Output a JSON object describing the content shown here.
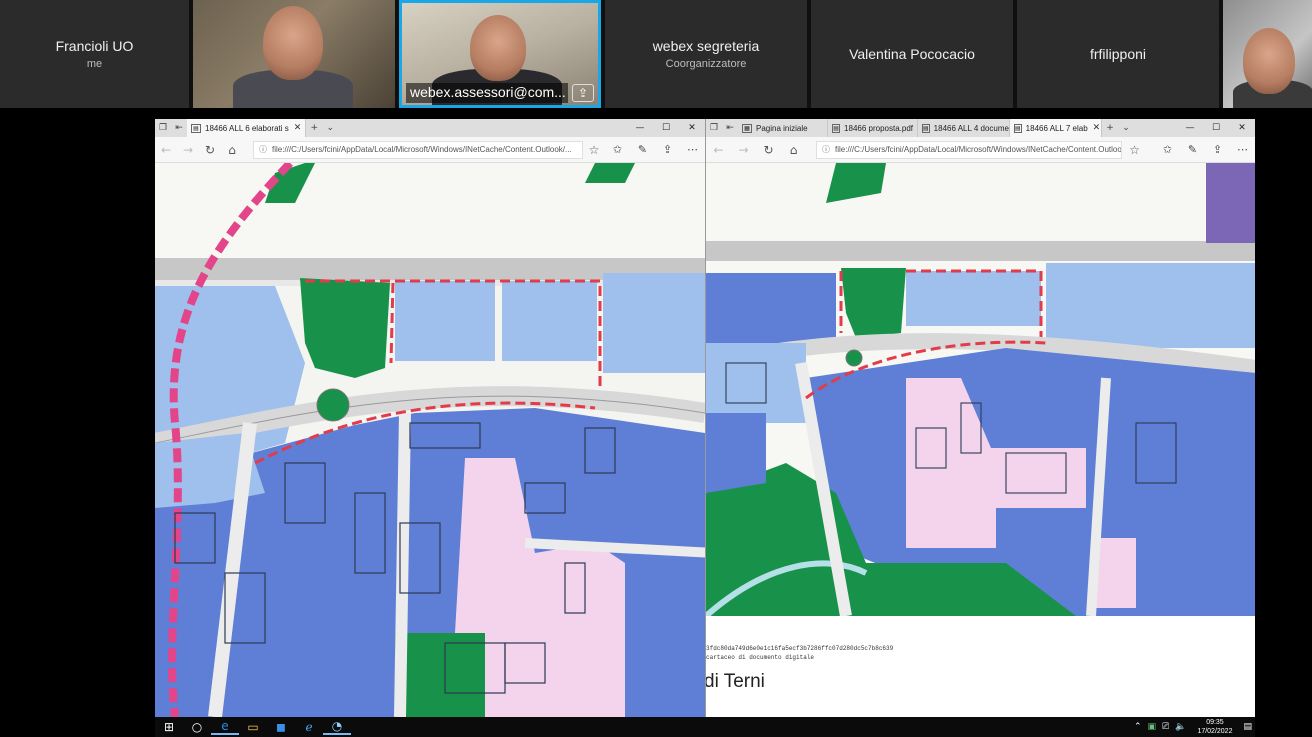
{
  "participants": {
    "tiles": [
      {
        "name": "Francioli UO",
        "sub": "me"
      },
      {
        "name": "webex segreteria",
        "sub": "Coorganizzatore"
      },
      {
        "name": "Valentina Pococacio",
        "sub": ""
      },
      {
        "name": "frfilipponi",
        "sub": ""
      }
    ],
    "active_speaker_label": "webex.assessori@com...",
    "active_speaker_color": "#19a7e8"
  },
  "left_browser": {
    "tab_label": "18466 ALL 6 elaborati s",
    "url": "file:///C:/Users/fcini/AppData/Local/Microsoft/Windows/INetCache/Content.Outlook/..."
  },
  "right_browser": {
    "tabs": [
      "Pagina iniziale",
      "18466 proposta.pdf",
      "18466 ALL 4 docume",
      "18466 ALL 7 elab"
    ],
    "url": "file:///C:/Users/fcini/AppData/Local/Microsoft/Windows/INetCache/Content.Outlook/..."
  },
  "document": {
    "hash_line": "3fdc80da749d6e0e1c16fa5ecf3b7286ffc07d280dc5c7b8c639",
    "hash_line2": "cartaceo di documento digitale",
    "city": "di Terni"
  },
  "taskbar": {
    "time": "09:35",
    "date": "17/02/2022"
  },
  "map_colors": {
    "blue_dark": "#5f7fd6",
    "blue_light": "#9fbfec",
    "green": "#18924a",
    "pink": "#f3d4ec",
    "red_dash": "#e23b4a",
    "magenta": "#e2458a"
  }
}
